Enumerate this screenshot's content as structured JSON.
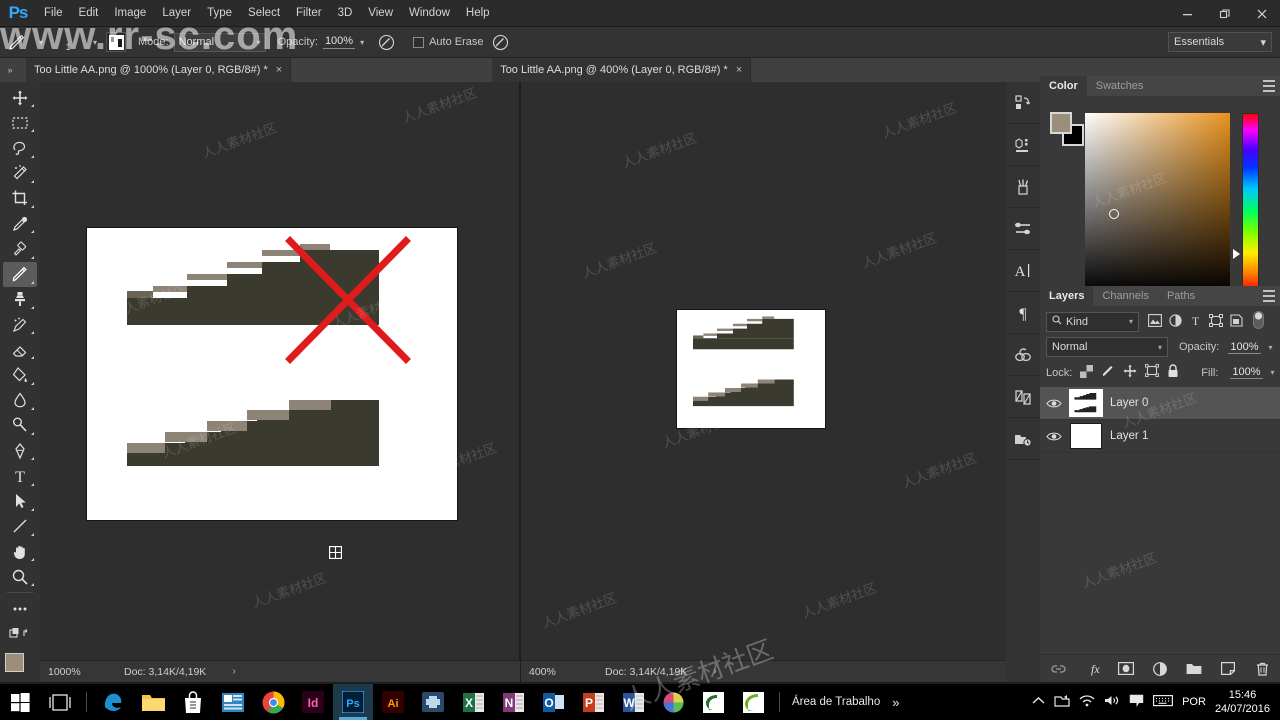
{
  "app": {
    "name": "Adobe Photoshop",
    "logo": "Ps",
    "accent": "#31a8ff"
  },
  "menubar": {
    "items": [
      {
        "label": "File"
      },
      {
        "label": "Edit"
      },
      {
        "label": "Image"
      },
      {
        "label": "Layer"
      },
      {
        "label": "Type"
      },
      {
        "label": "Select"
      },
      {
        "label": "Filter"
      },
      {
        "label": "3D"
      },
      {
        "label": "View"
      },
      {
        "label": "Window"
      },
      {
        "label": "Help"
      }
    ],
    "window_controls": {
      "minimize": "minimize-icon",
      "restore": "restore-icon",
      "close": "close-icon"
    }
  },
  "options_bar": {
    "tool_icon": "pencil-icon",
    "brush_size": "1",
    "brush_preset_icon": "brush-preset-icon",
    "mode_label": "Mode:",
    "mode_value": "Normal",
    "opacity_label": "Opacity:",
    "opacity_value": "100%",
    "pressure_opacity_icon": "tablet-pressure-opacity-icon",
    "auto_erase_label": "Auto Erase",
    "auto_erase_checked": false,
    "pressure_size_icon": "tablet-pressure-size-icon",
    "workspace": "Essentials"
  },
  "tabs": [
    {
      "title": "Too Little AA.png @ 1000% (Layer 0, RGB/8#) *",
      "active": true,
      "close": "×"
    },
    {
      "title": "Too Little AA.png @ 400% (Layer 0, RGB/8#) *",
      "active": false,
      "close": "×"
    }
  ],
  "toolbar": {
    "tools": [
      {
        "name": "move-tool",
        "icon": "move-icon",
        "selected": false
      },
      {
        "name": "rectangular-marquee-tool",
        "icon": "marquee-icon",
        "selected": false
      },
      {
        "name": "lasso-tool",
        "icon": "lasso-icon",
        "selected": false
      },
      {
        "name": "magic-wand-tool",
        "icon": "magic-wand-icon",
        "selected": false
      },
      {
        "name": "crop-tool",
        "icon": "crop-icon",
        "selected": false
      },
      {
        "name": "eyedropper-tool",
        "icon": "eyedropper-icon",
        "selected": false
      },
      {
        "name": "spot-healing-brush-tool",
        "icon": "healing-brush-icon",
        "selected": false
      },
      {
        "name": "brush-tool",
        "icon": "pencil-icon",
        "selected": true
      },
      {
        "name": "clone-stamp-tool",
        "icon": "clone-stamp-icon",
        "selected": false
      },
      {
        "name": "history-brush-tool",
        "icon": "history-brush-icon",
        "selected": false
      },
      {
        "name": "eraser-tool",
        "icon": "eraser-icon",
        "selected": false
      },
      {
        "name": "gradient-tool",
        "icon": "paint-bucket-icon",
        "selected": false
      },
      {
        "name": "blur-tool",
        "icon": "blur-icon",
        "selected": false
      },
      {
        "name": "dodge-tool",
        "icon": "dodge-icon",
        "selected": false
      },
      {
        "name": "pen-tool",
        "icon": "pen-icon",
        "selected": false
      },
      {
        "name": "type-tool",
        "icon": "type-icon",
        "selected": false
      },
      {
        "name": "path-selection-tool",
        "icon": "path-arrow-icon",
        "selected": false
      },
      {
        "name": "line-tool",
        "icon": "line-icon",
        "selected": false
      },
      {
        "name": "hand-tool",
        "icon": "hand-icon",
        "selected": false
      },
      {
        "name": "zoom-tool",
        "icon": "zoom-icon",
        "selected": false
      },
      {
        "name": "edit-toolbar",
        "icon": "ellipsis-icon",
        "selected": false
      },
      {
        "name": "quick-mask",
        "icon": "quick-mask-icon",
        "selected": false
      }
    ],
    "foreground_color": "#9b8e7a",
    "background_color": "#ffffff"
  },
  "documents": [
    {
      "name": "Too Little AA.png",
      "zoom": "1000%",
      "doc_info": "Doc: 3,14K/4,19K",
      "arrow": "›"
    },
    {
      "name": "Too Little AA.png",
      "zoom": "400%",
      "doc_info": "Doc: 3,14K/4,19K",
      "arrow": "›"
    }
  ],
  "icon_dock": [
    {
      "name": "history-panel-icon",
      "label": "History"
    },
    {
      "name": "properties-panel-icon",
      "label": "Properties"
    },
    {
      "name": "brushes-panel-icon",
      "label": "Brushes"
    },
    {
      "name": "brush-settings-panel-icon",
      "label": "Brush Settings"
    },
    {
      "name": "character-panel-icon",
      "label": "Character"
    },
    {
      "name": "paragraph-panel-icon",
      "label": "Paragraph"
    },
    {
      "name": "libraries-panel-icon",
      "label": "CC Libraries"
    },
    {
      "name": "adjustments-panel-icon",
      "label": "Adjustments"
    },
    {
      "name": "timeline-panel-icon",
      "label": "Timeline"
    }
  ],
  "color_panel": {
    "tabs": [
      {
        "label": "Color",
        "active": true
      },
      {
        "label": "Swatches",
        "active": false
      }
    ],
    "foreground_color": "#9b8e7a",
    "background_color": "#000000",
    "field_hue_color": "#e8921e",
    "menu_icon": "panel-menu-icon"
  },
  "layers_panel": {
    "tabs": [
      {
        "label": "Layers",
        "active": true
      },
      {
        "label": "Channels",
        "active": false
      },
      {
        "label": "Paths",
        "active": false
      }
    ],
    "menu_icon": "panel-menu-icon",
    "filter_label": "Kind",
    "filter_icons": [
      "filter-pixel-icon",
      "filter-adjustment-icon",
      "filter-type-icon",
      "filter-shape-icon",
      "filter-smart-object-icon"
    ],
    "filter_toggle": "filter-power-toggle",
    "blend_mode": "Normal",
    "opacity_label": "Opacity:",
    "opacity_value": "100%",
    "lock_label": "Lock:",
    "lock_icons": [
      "lock-transparent-pixels-icon",
      "lock-image-pixels-icon",
      "lock-position-icon",
      "lock-artboard-icon",
      "lock-all-icon"
    ],
    "fill_label": "Fill:",
    "fill_value": "100%",
    "layers": [
      {
        "name": "Layer 0",
        "visible": true,
        "selected": true,
        "thumb": "artwork"
      },
      {
        "name": "Layer 1",
        "visible": true,
        "selected": false,
        "thumb": "white"
      }
    ],
    "footer_icons": [
      {
        "name": "link-layers-icon"
      },
      {
        "name": "layer-styles-fx-icon",
        "label": "fx"
      },
      {
        "name": "add-layer-mask-icon"
      },
      {
        "name": "new-adjustment-layer-icon"
      },
      {
        "name": "new-group-icon"
      },
      {
        "name": "new-layer-icon"
      },
      {
        "name": "delete-layer-icon"
      }
    ]
  },
  "canvas": {
    "brush_cursor_icon": "brush-cursor-crosshair",
    "artwork": {
      "stair_dark": "#3b3a2e",
      "stair_light": "#8d8477",
      "x_mark_color": "#e01b1b",
      "background": "#ffffff"
    }
  },
  "taskbar": {
    "start_icon": "windows-start-icon",
    "task_view_icon": "task-view-icon",
    "apps": [
      {
        "name": "edge-icon",
        "label": "Microsoft Edge",
        "active": false
      },
      {
        "name": "file-explorer-icon",
        "label": "File Explorer",
        "active": false
      },
      {
        "name": "store-icon",
        "label": "Store",
        "active": false
      },
      {
        "name": "news-icon",
        "label": "News",
        "active": false
      },
      {
        "name": "chrome-icon",
        "label": "Google Chrome",
        "active": false
      },
      {
        "name": "indesign-icon",
        "label": "Id",
        "active": false
      },
      {
        "name": "photoshop-icon",
        "label": "Ps",
        "active": true
      },
      {
        "name": "illustrator-icon",
        "label": "Ai",
        "active": false
      },
      {
        "name": "premiere-icon",
        "label": "Premiere",
        "active": false
      },
      {
        "name": "excel-icon",
        "label": "X",
        "active": false
      },
      {
        "name": "onenote-icon",
        "label": "N",
        "active": false
      },
      {
        "name": "outlook-icon",
        "label": "O",
        "active": false
      },
      {
        "name": "powerpoint-icon",
        "label": "P",
        "active": false
      },
      {
        "name": "word-icon",
        "label": "W",
        "active": false
      },
      {
        "name": "color-wheel-icon",
        "label": "Color",
        "active": false
      },
      {
        "name": "camtasia-icon",
        "label": "Camtasia",
        "active": false
      },
      {
        "name": "camtasia-green-icon",
        "label": "Camtasia Studio",
        "active": false
      }
    ],
    "desktop_label": "Área de Trabalho",
    "overflow": "»",
    "tray": [
      {
        "name": "show-hidden-icons-chevron"
      },
      {
        "name": "removable-media-icon"
      },
      {
        "name": "network-icon"
      },
      {
        "name": "volume-icon"
      },
      {
        "name": "action-center-icon"
      },
      {
        "name": "keyboard-icon"
      }
    ],
    "language": "POR",
    "time": "15:46",
    "date": "24/07/2016"
  },
  "watermarks": {
    "site": "www.rr-sc.com",
    "cn": "人人素材社区"
  }
}
